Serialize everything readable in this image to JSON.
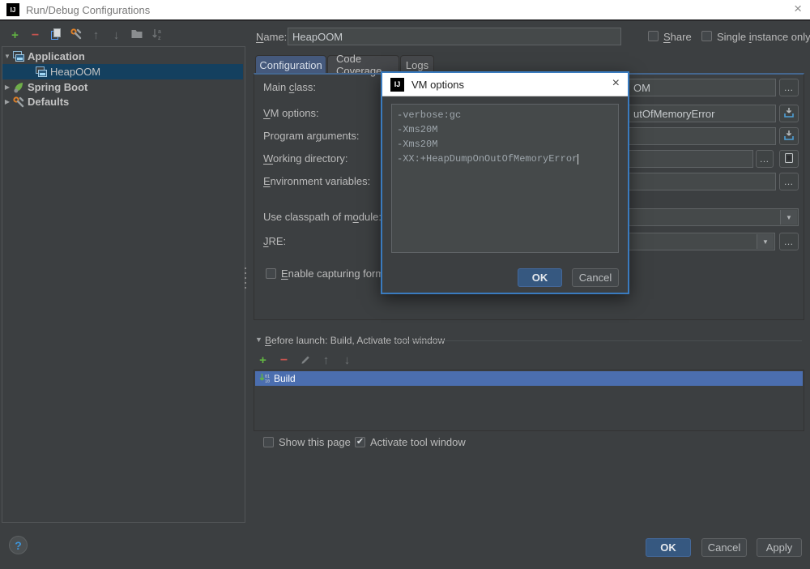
{
  "colors": {
    "bg": "#3c3f41",
    "titlebar-bg": "#ffffff",
    "titlebar-text": "#787878",
    "text": "#bbbbbb",
    "field-bg": "#45494a",
    "field-border": "#5f6365",
    "tree-sel": "#14405f",
    "list-sel": "#4b6eaf",
    "tab-sel": "#45597c",
    "tab-bg": "#46484b",
    "accent": "#3a7bbf",
    "primary": "#365880",
    "btn-bg": "#43474a",
    "btn-border": "#5e6163",
    "green": "#62b543",
    "red": "#c75450",
    "help": "#3d94d9",
    "mono": "#9da5ab",
    "sep": "#4a4e50",
    "content-top": "#45678f"
  },
  "titlebar": {
    "logo": "IJ",
    "title": "Run/Debug Configurations",
    "close_glyph": "×"
  },
  "left": {
    "toolbar": {
      "add": "+",
      "remove": "−",
      "up": "↑",
      "down": "↓"
    },
    "tree": {
      "expanded_glyph": "▼",
      "collapsed_glyph": "▶",
      "items": [
        {
          "label": "Application"
        },
        {
          "label": "HeapOOM"
        },
        {
          "label": "Spring Boot"
        },
        {
          "label": "Defaults"
        }
      ]
    }
  },
  "header": {
    "name_label": {
      "text": "Name:",
      "u": 0
    },
    "name_value": "HeapOOM",
    "share": {
      "text": "Share",
      "u": 0,
      "checked": false
    },
    "single_instance": {
      "text": "Single instance only",
      "u": 7,
      "checked": false
    }
  },
  "tabs": [
    {
      "label": "Configuration",
      "selected": true
    },
    {
      "label": "Code Coverage",
      "selected": false
    },
    {
      "label": "Logs",
      "selected": false
    }
  ],
  "form": {
    "main_class": {
      "label": {
        "text": "Main class:",
        "u": 5
      },
      "visible_value": "OM",
      "browse": "…"
    },
    "vm_options": {
      "label": {
        "text": "VM options:",
        "u": 0
      },
      "visible_value": "utOfMemoryError"
    },
    "program_arguments": {
      "label": {
        "text": "Program arguments:",
        "u": 10
      },
      "value": ""
    },
    "working_directory": {
      "label": {
        "text": "Working directory:",
        "u": 0
      },
      "value": "",
      "browse": "…"
    },
    "environment_variables": {
      "label": {
        "text": "Environment variables:",
        "u": 0
      },
      "value": "",
      "browse": "…"
    },
    "use_classpath": {
      "label": {
        "text": "Use classpath of module:",
        "u": 18
      },
      "value": "",
      "arrow": "▼"
    },
    "jre": {
      "label": {
        "text": "JRE:",
        "u": 0
      },
      "value": "",
      "arrow": "▼",
      "browse": "…"
    },
    "enable_capturing": {
      "label": {
        "text": "Enable capturing form",
        "u": 0
      },
      "checked": false
    }
  },
  "dialog": {
    "logo": "IJ",
    "title": "VM options",
    "close_glyph": "×",
    "lines": [
      "-verbose:gc",
      "-Xms20M",
      "-Xms20M",
      "-XX:+HeapDumpOnOutOfMemoryError"
    ],
    "ok": "OK",
    "cancel": "Cancel"
  },
  "before_launch": {
    "collapse_glyph": "▼",
    "header": {
      "text": "Before launch: Build, Activate tool window",
      "u": 0
    },
    "toolbar": {
      "add": "+",
      "remove": "−",
      "up": "↑",
      "down": "↓"
    },
    "items": [
      {
        "label": "Build"
      }
    ]
  },
  "footer_options": {
    "show_this_page": {
      "text": "Show this page",
      "checked": false
    },
    "activate_tool_window": {
      "text": "Activate tool window",
      "checked": true
    }
  },
  "footer": {
    "help": "?",
    "ok": "OK",
    "cancel": "Cancel",
    "apply": "Apply"
  },
  "check_glyph": "✔"
}
